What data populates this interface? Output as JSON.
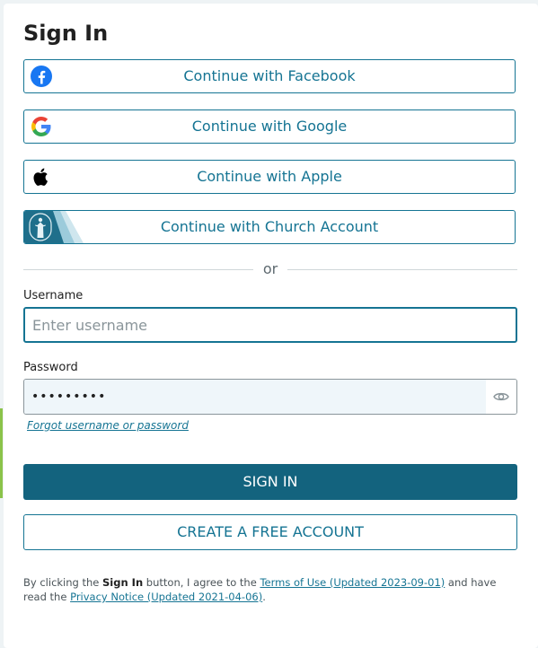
{
  "title": "Sign In",
  "social": {
    "facebook_label": "Continue with Facebook",
    "google_label": "Continue with Google",
    "apple_label": "Continue with Apple",
    "church_label": "Continue with Church Account"
  },
  "divider_text": "or",
  "username": {
    "label": "Username",
    "placeholder": "Enter username",
    "value": ""
  },
  "password": {
    "label": "Password",
    "value": "•••••••••"
  },
  "forgot_link": "Forgot username or password",
  "signin_label": "SIGN IN",
  "create_label": "CREATE A FREE ACCOUNT",
  "legal": {
    "prefix": "By clicking the ",
    "signin_bold": "Sign In",
    "middle": " button, I agree to the ",
    "terms_link": "Terms of Use (Updated 2023-09-01)",
    "after_terms": " and have read the ",
    "privacy_link": "Privacy Notice (Updated 2021-04-06)",
    "suffix": "."
  },
  "icons": {
    "facebook": "facebook-icon",
    "google": "google-icon",
    "apple": "apple-icon",
    "church": "church-christus-icon",
    "eye": "eye-icon"
  },
  "colors": {
    "accent": "#157493",
    "signin_bg": "#13637e",
    "facebook": "#1877f2",
    "password_bg": "#eff6fa",
    "edge_accent": "#8bc34a"
  }
}
